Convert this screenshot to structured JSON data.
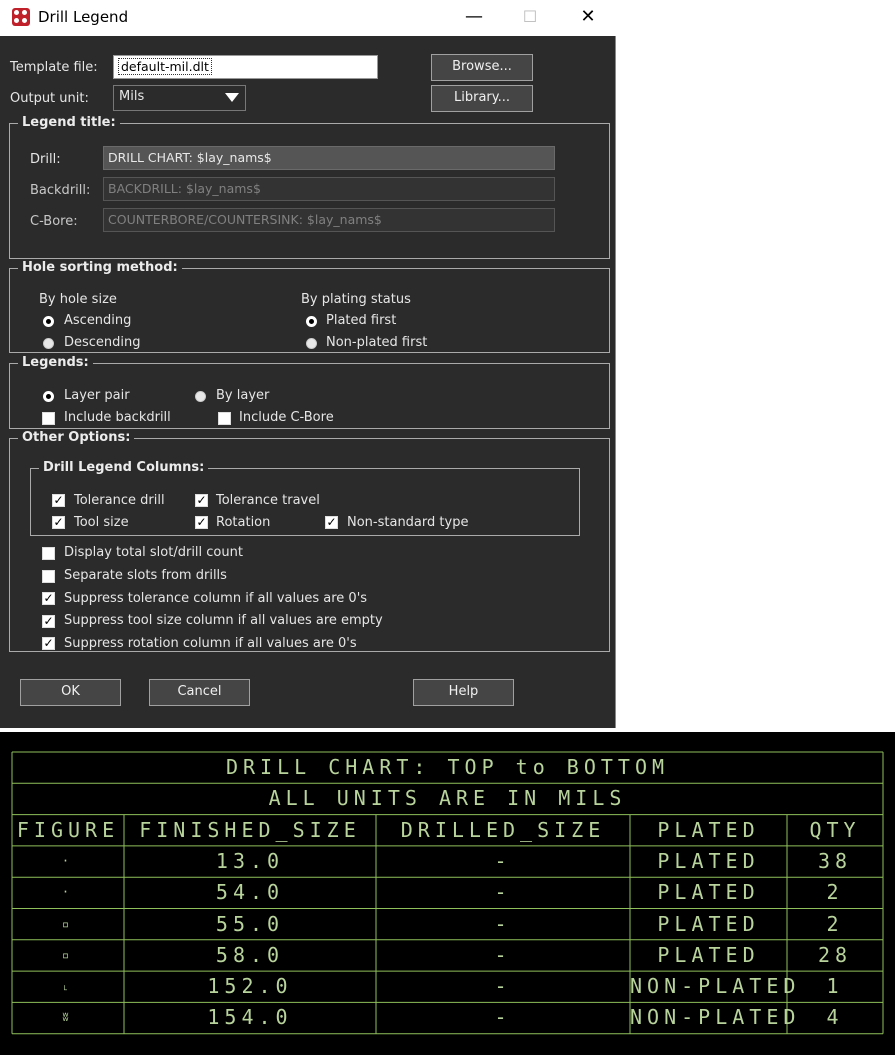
{
  "window": {
    "title": "Drill Legend",
    "minimize": "—",
    "maximize": "☐",
    "close": "✕"
  },
  "template": {
    "label": "Template file:",
    "value": "default-mil.dlt",
    "browse": "Browse..."
  },
  "output": {
    "label": "Output unit:",
    "value": "Mils",
    "library": "Library..."
  },
  "legend_title": {
    "heading": "Legend title:",
    "drill_label": "Drill:",
    "drill_value": "DRILL CHART: $lay_nams$",
    "backdrill_label": "Backdrill:",
    "backdrill_value": "BACKDRILL: $lay_nams$",
    "cbore_label": "C-Bore:",
    "cbore_value": "COUNTERBORE/COUNTERSINK: $lay_nams$"
  },
  "hole_sorting": {
    "heading": "Hole sorting method:",
    "by_size": "By hole size",
    "ascending": "Ascending",
    "descending": "Descending",
    "by_plating": "By plating status",
    "plated_first": "Plated first",
    "nonplated_first": "Non-plated first"
  },
  "legends": {
    "heading": "Legends:",
    "layer_pair": "Layer pair",
    "by_layer": "By layer",
    "include_backdrill": "Include backdrill",
    "include_cbore": "Include C-Bore"
  },
  "other_options": {
    "heading": "Other Options:",
    "columns_heading": "Drill Legend Columns:",
    "tolerance_drill": "Tolerance drill",
    "tolerance_travel": "Tolerance travel",
    "tool_size": "Tool size",
    "rotation": "Rotation",
    "nonstandard_type": "Non-standard type",
    "display_total": "Display total slot/drill count",
    "separate_slots": "Separate slots from drills",
    "suppress_tolerance": "Suppress tolerance column if all values are 0's",
    "suppress_toolsize": "Suppress tool size column if all values are empty",
    "suppress_rotation": "Suppress rotation column if all values are 0's"
  },
  "buttons": {
    "ok": "OK",
    "cancel": "Cancel",
    "help": "Help"
  },
  "check_mark": "✓",
  "colors": {
    "chart_line": "#8fbf5a",
    "chart_text": "#b8d39b",
    "dialog_bg": "#2b2b2b"
  },
  "chart_data": {
    "type": "table",
    "title": "DRILL CHART: TOP to BOTTOM",
    "subtitle": "ALL UNITS ARE IN MILS",
    "columns": [
      "FIGURE",
      "FINISHED_SIZE",
      "DRILLED_SIZE",
      "PLATED",
      "QTY"
    ],
    "rows": [
      {
        "figure": "·",
        "finished_size": "13.0",
        "drilled_size": "-",
        "plated": "PLATED",
        "qty": "38"
      },
      {
        "figure": "·",
        "finished_size": "54.0",
        "drilled_size": "-",
        "plated": "PLATED",
        "qty": "2"
      },
      {
        "figure": "▫",
        "finished_size": "55.0",
        "drilled_size": "-",
        "plated": "PLATED",
        "qty": "2"
      },
      {
        "figure": "▫",
        "finished_size": "58.0",
        "drilled_size": "-",
        "plated": "PLATED",
        "qty": "28"
      },
      {
        "figure": "˪",
        "finished_size": "152.0",
        "drilled_size": "-",
        "plated": "NON-PLATED",
        "qty": "1"
      },
      {
        "figure": "ʬ",
        "finished_size": "154.0",
        "drilled_size": "-",
        "plated": "NON-PLATED",
        "qty": "4"
      }
    ]
  }
}
